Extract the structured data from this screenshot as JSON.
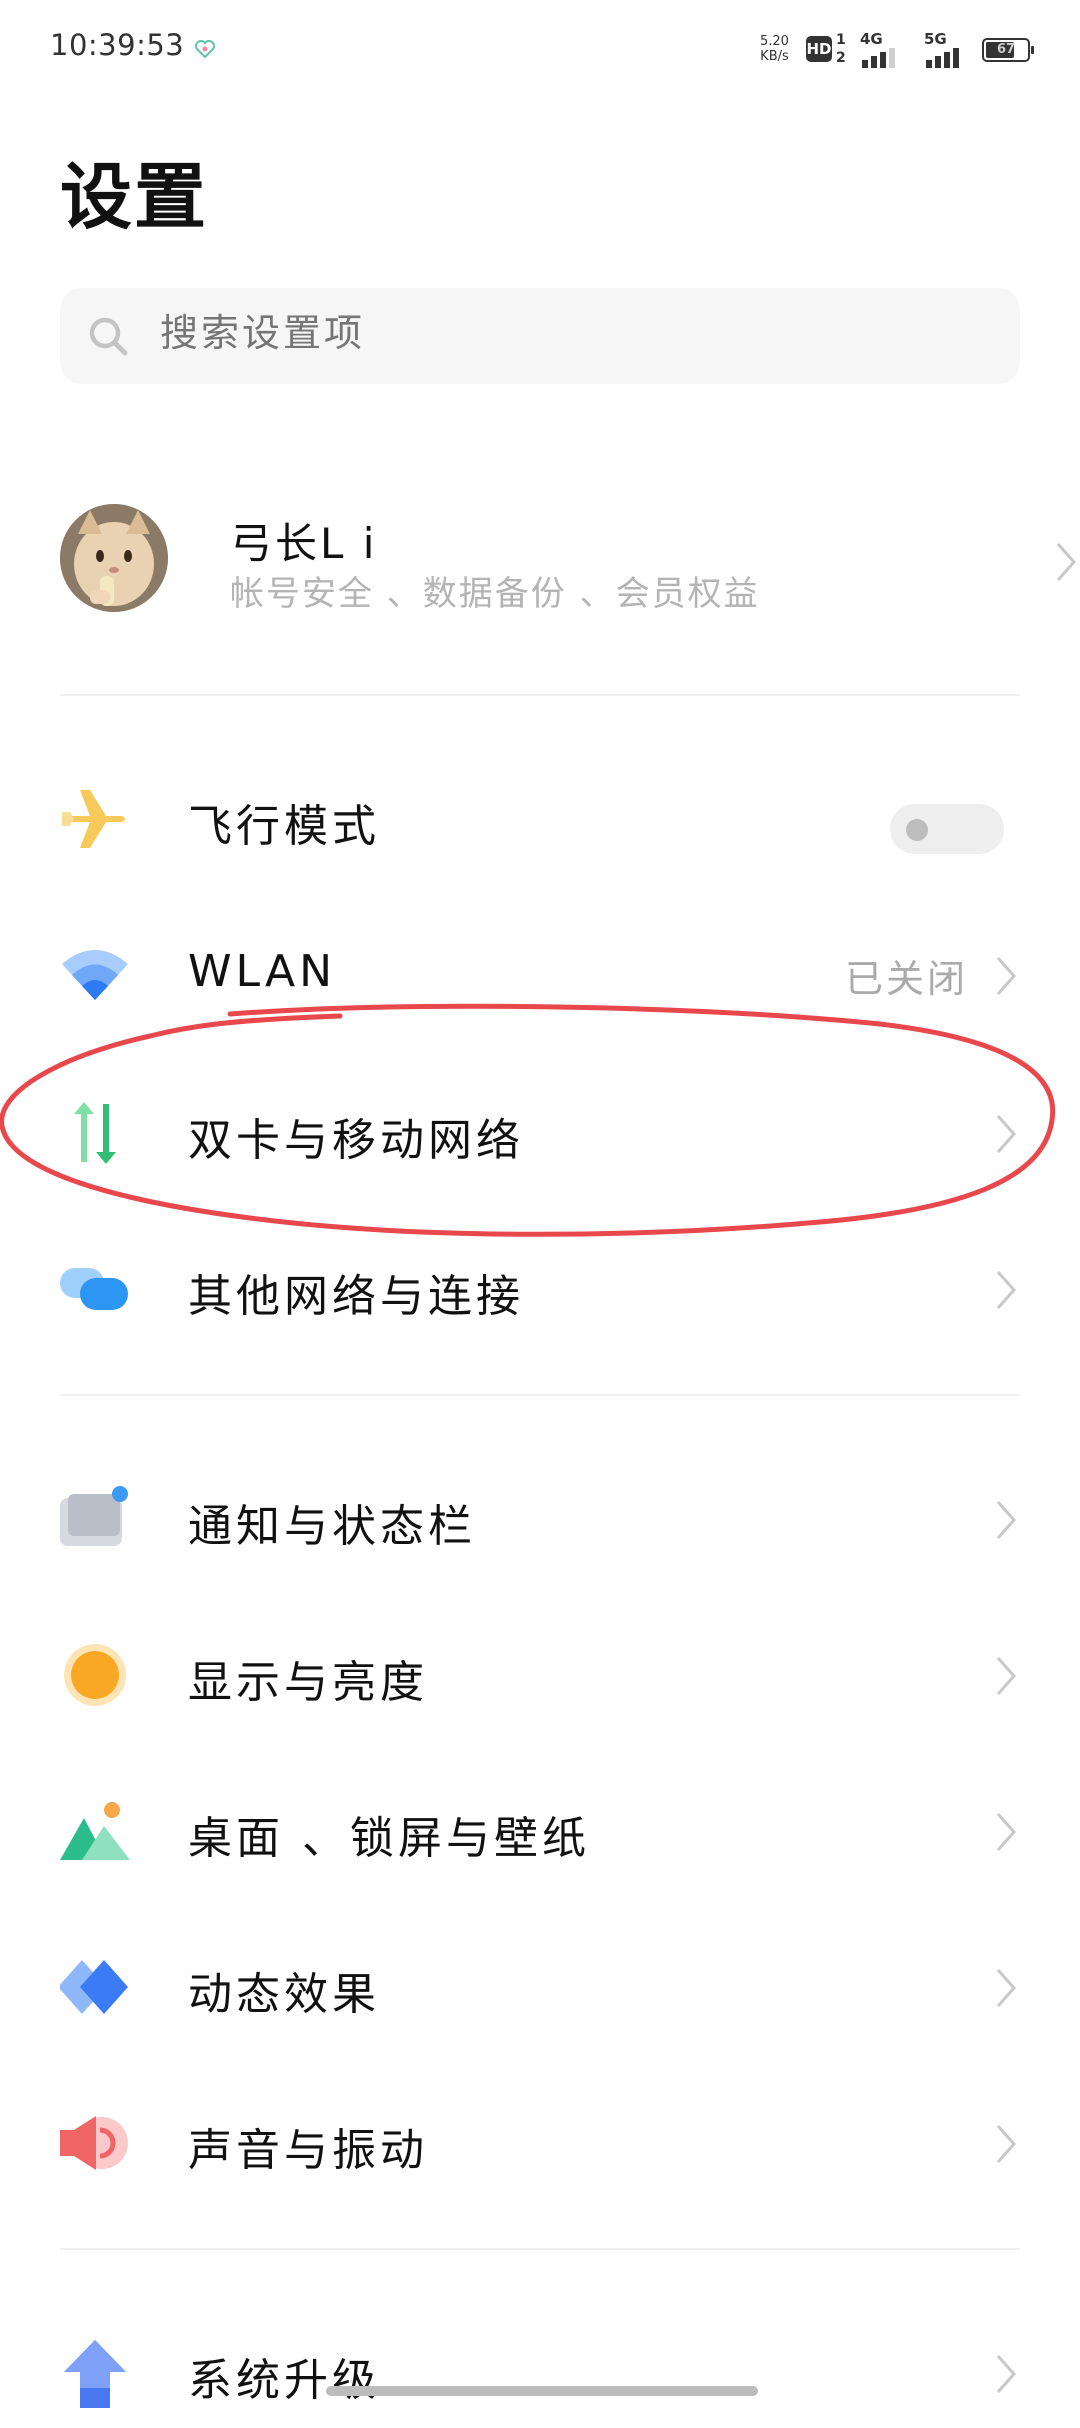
{
  "status_bar": {
    "time": "10:39:53",
    "net_speed_value": "5.20",
    "net_speed_unit": "KB/s",
    "hd_label": "HD",
    "sim1_label": "1",
    "sim2_label": "2",
    "net1_type": "4G",
    "net2_type": "5G",
    "battery": "67"
  },
  "page": {
    "title": "设置"
  },
  "search": {
    "placeholder": "搜索设置项"
  },
  "account": {
    "name": "弓长L i",
    "subtitle": "帐号安全 、数据备份 、会员权益"
  },
  "groups": [
    {
      "items": [
        {
          "label": "飞行模式",
          "icon": "airplane-icon",
          "toggle": false
        },
        {
          "label": "WLAN",
          "icon": "wifi-icon",
          "value": "已关闭"
        },
        {
          "label": "双卡与移动网络",
          "icon": "mobile-data-icon"
        },
        {
          "label": "其他网络与连接",
          "icon": "connections-icon"
        }
      ]
    },
    {
      "items": [
        {
          "label": "通知与状态栏",
          "icon": "notification-icon"
        },
        {
          "label": "显示与亮度",
          "icon": "brightness-icon"
        },
        {
          "label": "桌面 、锁屏与壁纸",
          "icon": "wallpaper-icon"
        },
        {
          "label": "动态效果",
          "icon": "animation-icon"
        },
        {
          "label": "声音与振动",
          "icon": "sound-icon"
        }
      ]
    },
    {
      "items": [
        {
          "label": "系统升级",
          "icon": "system-upgrade-icon"
        }
      ]
    }
  ],
  "colors": {
    "annotation_red": "#e8484c",
    "airplane": "#f7c85a",
    "wifi": "#3b87f5",
    "mobile_data": "#3cc97c",
    "connections": "#4aa6f5",
    "brightness": "#f9a826",
    "wallpaper": "#2bbd8c",
    "animation": "#3b7cf5",
    "sound": "#ef6565",
    "upgrade": "#4a78f0"
  }
}
